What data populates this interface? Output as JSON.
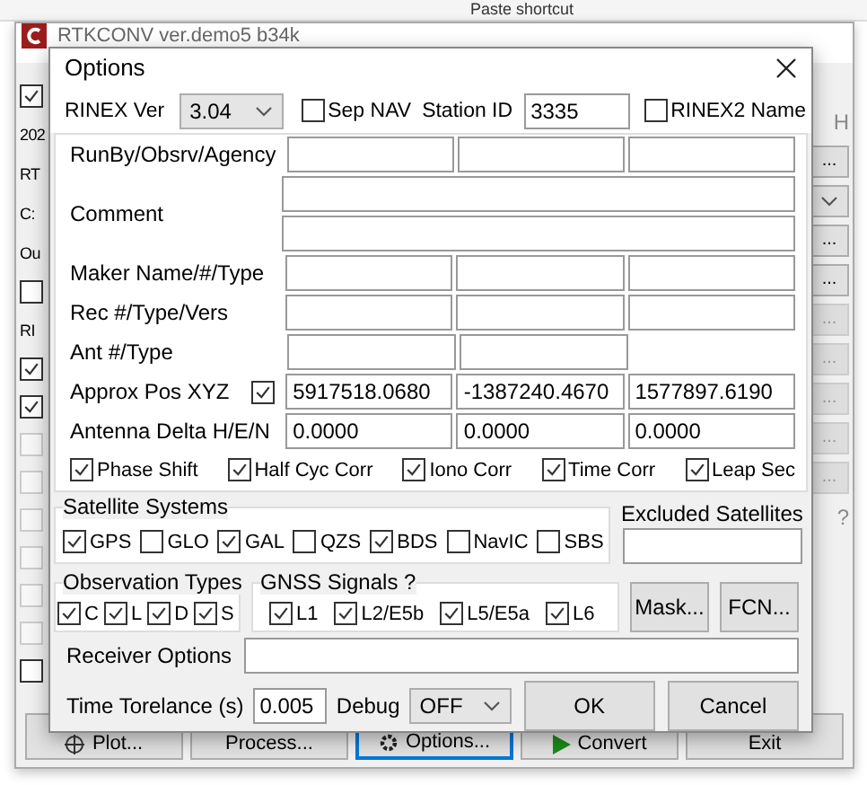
{
  "explorer_ribbon": {
    "text": "Paste shortcut"
  },
  "background_window": {
    "title": "RTKCONV ver.demo5 b34k",
    "left_items": [
      {
        "kind": "checkbox",
        "checked": true,
        "disabled": false
      },
      {
        "kind": "text",
        "text": "202"
      },
      {
        "kind": "text",
        "text": "RT"
      },
      {
        "kind": "text",
        "text": "C:"
      },
      {
        "kind": "text",
        "text": "Ou"
      },
      {
        "kind": "checkbox",
        "checked": false,
        "disabled": false
      },
      {
        "kind": "text",
        "text": "RI"
      },
      {
        "kind": "checkbox",
        "checked": true,
        "disabled": false
      },
      {
        "kind": "checkbox",
        "checked": true,
        "disabled": false
      },
      {
        "kind": "checkbox",
        "checked": false,
        "disabled": true
      },
      {
        "kind": "checkbox",
        "checked": false,
        "disabled": true
      },
      {
        "kind": "checkbox",
        "checked": false,
        "disabled": true
      },
      {
        "kind": "checkbox",
        "checked": false,
        "disabled": true
      },
      {
        "kind": "checkbox",
        "checked": false,
        "disabled": true
      },
      {
        "kind": "checkbox",
        "checked": false,
        "disabled": true
      },
      {
        "kind": "checkbox",
        "checked": false,
        "disabled": false
      }
    ],
    "right_items": [
      {
        "kind": "text",
        "text": "H"
      },
      {
        "kind": "button",
        "text": "...",
        "disabled": false
      },
      {
        "kind": "dropdown"
      },
      {
        "kind": "button",
        "text": "...",
        "disabled": false
      },
      {
        "kind": "button",
        "text": "...",
        "disabled": false
      },
      {
        "kind": "button",
        "text": "...",
        "disabled": true
      },
      {
        "kind": "button",
        "text": "...",
        "disabled": true
      },
      {
        "kind": "button",
        "text": "...",
        "disabled": true
      },
      {
        "kind": "button",
        "text": "...",
        "disabled": true
      },
      {
        "kind": "button",
        "text": "...",
        "disabled": true
      },
      {
        "kind": "text",
        "text": "?"
      }
    ],
    "buttons": [
      {
        "label": "Plot...",
        "kind": "plot",
        "selected": false
      },
      {
        "label": "Process...",
        "kind": "plain",
        "selected": false
      },
      {
        "label": "Options...",
        "kind": "options",
        "selected": true
      },
      {
        "label": "Convert",
        "kind": "convert",
        "selected": false
      },
      {
        "label": "Exit",
        "kind": "plain",
        "selected": false
      }
    ]
  },
  "dialog": {
    "title": "Options",
    "rinex_ver": {
      "label": "RINEX Ver",
      "value": "3.04"
    },
    "sep_nav": {
      "label": "Sep NAV",
      "checked": false
    },
    "station_id": {
      "label": "Station ID",
      "value": "3335"
    },
    "rinex2_name": {
      "label": "RINEX2 Name",
      "checked": false
    },
    "header_rows": [
      {
        "label": "RunBy/Obsrv/Agency",
        "kind": "triple"
      },
      {
        "label": "Comment",
        "kind": "double_line"
      },
      {
        "label": "Maker Name/#/Type",
        "kind": "triple"
      },
      {
        "label": "Rec #/Type/Vers",
        "kind": "triple"
      },
      {
        "label": "Ant #/Type",
        "kind": "pair"
      },
      {
        "label": "Approx Pos XYZ",
        "kind": "triple",
        "checked": true,
        "values": [
          "5917518.0680",
          "-1387240.4670",
          "1577897.6190"
        ]
      },
      {
        "label": "Antenna Delta H/E/N",
        "kind": "triple",
        "values": [
          "0.0000",
          "0.0000",
          "0.0000"
        ]
      }
    ],
    "corrections": [
      {
        "label": "Phase Shift",
        "checked": true
      },
      {
        "label": "Half Cyc Corr",
        "checked": true
      },
      {
        "label": "Iono Corr",
        "checked": true
      },
      {
        "label": "Time Corr",
        "checked": true
      },
      {
        "label": "Leap Sec",
        "checked": true
      }
    ],
    "satellite_systems": {
      "title": "Satellite Systems",
      "items": [
        {
          "label": "GPS",
          "checked": true
        },
        {
          "label": "GLO",
          "checked": false
        },
        {
          "label": "GAL",
          "checked": true
        },
        {
          "label": "QZS",
          "checked": false
        },
        {
          "label": "BDS",
          "checked": true
        },
        {
          "label": "NavIC",
          "checked": false
        },
        {
          "label": "SBS",
          "checked": false
        }
      ]
    },
    "excluded_satellites": {
      "label": "Excluded Satellites"
    },
    "observation_types": {
      "title": "Observation Types",
      "items": [
        {
          "label": "C",
          "checked": true
        },
        {
          "label": "L",
          "checked": true
        },
        {
          "label": "D",
          "checked": true
        },
        {
          "label": "S",
          "checked": true
        }
      ]
    },
    "gnss_signals": {
      "title": "GNSS Signals  ?",
      "items": [
        {
          "label": "L1",
          "checked": true
        },
        {
          "label": "L2/E5b",
          "checked": true
        },
        {
          "label": "L5/E5a",
          "checked": true
        },
        {
          "label": "L6",
          "checked": true
        }
      ]
    },
    "mask_button": "Mask...",
    "fcn_button": "FCN...",
    "receiver_options": {
      "label": "Receiver Options"
    },
    "time_tolerance": {
      "label": "Time Torelance (s)",
      "value": "0.005"
    },
    "debug": {
      "label": "Debug",
      "value": "OFF"
    },
    "ok_button": "OK",
    "cancel_button": "Cancel"
  }
}
